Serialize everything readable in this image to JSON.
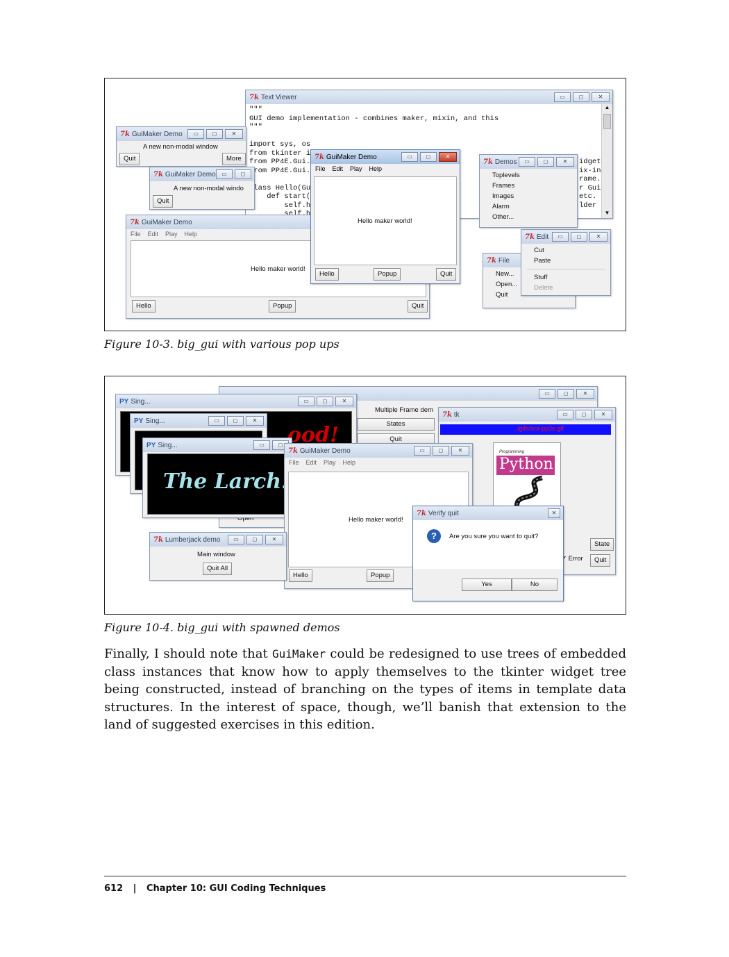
{
  "figure1": {
    "caption": "Figure 10-3. big_gui with various pop ups",
    "text_viewer": {
      "title": "Text Viewer",
      "code_lines": [
        "\"\"\"",
        "GUI demo implementation - combines maker, mixin, and this",
        "\"\"\"",
        "",
        "import sys, os",
        "from tkinter i",
        "from PP4E.Gui.",
        "from PP4E.Gui.",
        "",
        "class Hello(Gu",
        "    def start(",
        "        self.h",
        "        self.h"
      ],
      "code_right": [
        "idget classes",
        "ix-in",
        "rame.",
        "r Gui",
        "etc.",
        "lder"
      ]
    },
    "guimaker_small_1": {
      "title": "GuiMaker Demo",
      "label": "A new non-modal window",
      "quit": "Quit",
      "more": "More"
    },
    "guimaker_small_2": {
      "title": "GuiMaker Demo",
      "label": "A new non-modal windo",
      "quit": "Quit"
    },
    "guimaker_large": {
      "title": "GuiMaker Demo",
      "menus": [
        "File",
        "Edit",
        "Play",
        "Help"
      ],
      "message": "Hello maker world!",
      "hello": "Hello",
      "popup": "Popup",
      "quit": "Quit"
    },
    "guimaker_front": {
      "title": "GuiMaker Demo",
      "menus": [
        "File",
        "Edit",
        "Play",
        "Help"
      ],
      "message": "Hello maker world!",
      "hello": "Hello",
      "popup": "Popup",
      "quit": "Quit"
    },
    "demos": {
      "title": "Demos",
      "items": [
        "Toplevels",
        "Frames",
        "Images",
        "Alarm",
        "Other..."
      ]
    },
    "edit": {
      "title": "Edit",
      "items": [
        "Cut",
        "Paste"
      ],
      "items2": [
        "Stuff"
      ],
      "disabled": [
        "Delete"
      ]
    },
    "file": {
      "title": "File",
      "items": [
        "New...",
        "Open...",
        "Quit"
      ]
    }
  },
  "figure2": {
    "caption": "Figure 10-4. big_gui with spawned demos",
    "back_frame": {
      "label": "Multiple Frame dem",
      "states": "States",
      "quit": "Quit"
    },
    "sing_1": {
      "title": "Sing...",
      "slogan_fragment": "ood!"
    },
    "sing_2": {
      "title": "Sing..."
    },
    "sing_3": {
      "title": "Sing...",
      "slogan": "The Larch!"
    },
    "open_fragment": "Open",
    "tk": {
      "title": "tk",
      "path": "../gifs/ora-pp3e.gif",
      "book_title": "Python",
      "book_sub": "Programming",
      "state": "State",
      "error": "Error",
      "quit": "Quit"
    },
    "guimaker": {
      "title": "GuiMaker Demo",
      "menus": [
        "File",
        "Edit",
        "Play",
        "Help"
      ],
      "message": "Hello maker world!",
      "hello": "Hello",
      "popup": "Popup"
    },
    "lumberjack": {
      "title": "Lumberjack demo",
      "label": "Main window",
      "quit_all": "Quit All"
    },
    "verify": {
      "title": "Verify quit",
      "question": "Are you sure you want to quit?",
      "yes": "Yes",
      "no": "No"
    }
  },
  "paragraph": {
    "part1": "Finally, I should note that ",
    "code": "GuiMaker",
    "part2": " could be redesigned to use trees of embedded class instances that know how to apply themselves to the tkinter widget tree being constructed, instead of branching on the types of items in template data structures. In the interest of space, though, we’ll banish that extension to the land of suggested exercises in this edition."
  },
  "footer": {
    "page_number": "612",
    "separator": "|",
    "chapter": "Chapter 10:  GUI Coding Techniques"
  },
  "colors": {
    "titlebar": "#c9d6e8",
    "tk_logo": "#c0282e",
    "tk_path_bar": "#1010ff",
    "book_cover": "#c23a8c",
    "question_icon": "#2a5fb0"
  },
  "icons": {
    "window_minimize": "minimize-icon",
    "window_maximize": "maximize-icon",
    "window_close": "close-icon",
    "question": "question-icon",
    "tk_logo": "tk-logo-icon",
    "python_logo": "python-logo-icon"
  }
}
